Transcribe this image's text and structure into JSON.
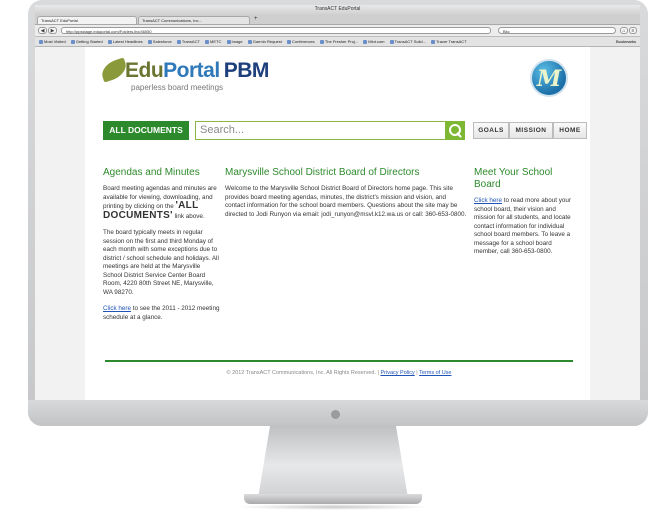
{
  "browser": {
    "window_title": "TransACT EduPortal",
    "tabs": [
      {
        "label": "TransACT EduPortal"
      },
      {
        "label": "TransACT Communications, Inc..."
      }
    ],
    "url": "http://ppsstage.eduportal.com/Folders.lhx/46050",
    "search_value": "Bkc",
    "bookmarks": [
      "Most Visited",
      "Getting Started",
      "Latest Headlines",
      "Salesforce",
      "TransACT",
      "METC",
      "Image",
      "Garmin Request",
      "Conferences",
      "The Fresher Proj...",
      "Mint.com",
      "TransACT Solid...",
      "Tracer TransACT"
    ],
    "bookmarks_menu": "Bookmarks"
  },
  "brand": {
    "logo_edu": "Edu",
    "logo_portal": "Portal",
    "logo_pbm": "PBM",
    "tagline": "paperless board meetings",
    "district_logo_letter": "M"
  },
  "toolbar": {
    "all_documents": "ALL DOCUMENTS",
    "search_placeholder": "Search...",
    "nav": [
      "GOALS",
      "MISSION",
      "HOME"
    ]
  },
  "left": {
    "title": "Agendas and Minutes",
    "p1_a": "Board meeting agendas and minutes are available for viewing, downloading, and printing by clicking on the",
    "p1_link": "'ALL DOCUMENTS'",
    "p1_b": "link above.",
    "p2": "The board typically meets in regular session on the first and third Monday of each month with some exceptions due to district / school schedule and holidays.  All meetings are held at the Marysville School District Service Center Board Room, 4220 80th Street NE, Marysville, WA 98270.",
    "p3_link": "Click here",
    "p3_text": "to see the 2011 - 2012 meeting schedule at a glance."
  },
  "center": {
    "title": "Marysville School District Board of Directors",
    "body": "Welcome to the Marysville School District Board of Directors home page. This site provides board meeting agendas, minutes, the district's mission and vision, and contact information for the school board members.  Questions about the site may be directed to Jodi Runyon via email: jodi_runyon@msvl.k12.wa.us or call:  360-653-0800."
  },
  "right": {
    "title": "Meet Your School Board",
    "link": "Click here",
    "body": "to read more about your school board, their vision and mission for all students, and locate contact information for individual school board members.  To leave a message for a school board member, call 360-653-0800."
  },
  "footer": {
    "copyright": "© 2012 TransACT Communications, Inc. All Rights Reserved.",
    "privacy": "Privacy Policy",
    "terms": "Terms of Use"
  },
  "colors": {
    "accent_green": "#2d8a2c",
    "link_blue": "#1f53b5"
  }
}
